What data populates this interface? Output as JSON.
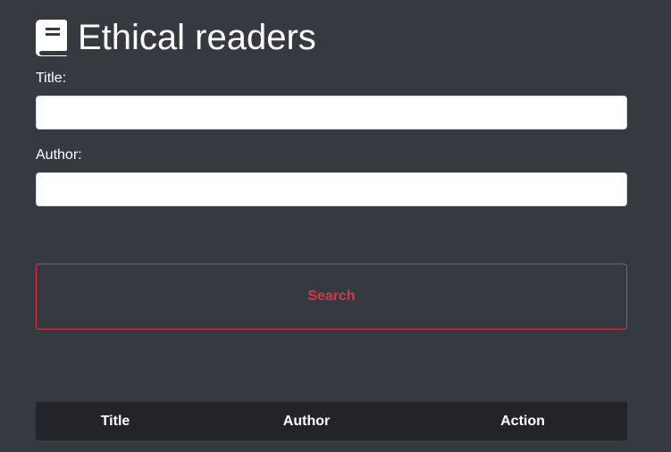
{
  "header": {
    "title": "Ethical readers",
    "icon": "book-icon"
  },
  "form": {
    "title_label": "Title:",
    "title_value": "",
    "author_label": "Author:",
    "author_value": "",
    "search_label": "Search"
  },
  "table": {
    "columns": [
      "Title",
      "Author",
      "Action"
    ]
  },
  "colors": {
    "background": "#343a40",
    "accent": "#dc3545",
    "table_header": "#212529"
  }
}
